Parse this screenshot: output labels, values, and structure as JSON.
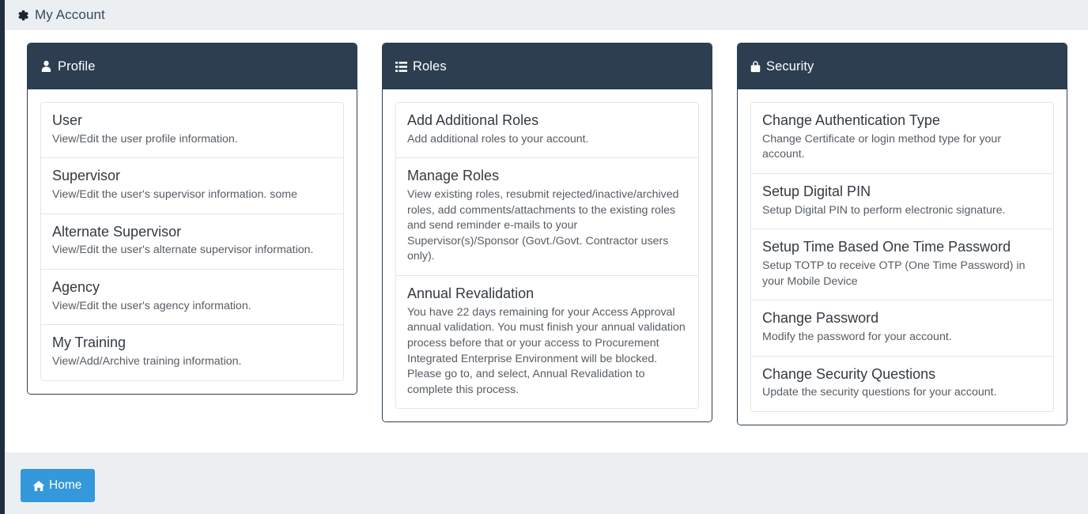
{
  "topbar": {
    "icon": "gear-icon",
    "title": "My Account"
  },
  "panels": [
    {
      "key": "profile",
      "icon": "user-icon",
      "title": "Profile",
      "items": [
        {
          "title": "User",
          "desc": "View/Edit the user profile information."
        },
        {
          "title": "Supervisor",
          "desc": "View/Edit the user's supervisor information. some"
        },
        {
          "title": "Alternate Supervisor",
          "desc": "View/Edit the user's alternate supervisor information."
        },
        {
          "title": "Agency",
          "desc": "View/Edit the user's agency information."
        },
        {
          "title": "My Training",
          "desc": "View/Add/Archive training information."
        }
      ]
    },
    {
      "key": "roles",
      "icon": "list-icon",
      "title": "Roles",
      "items": [
        {
          "title": "Add Additional Roles",
          "desc": "Add additional roles to your account."
        },
        {
          "title": "Manage Roles",
          "desc": "View existing roles, resubmit rejected/inactive/archived roles, add comments/attachments to the existing roles and send reminder e-mails to your Supervisor(s)/Sponsor (Govt./Govt. Contractor users only)."
        },
        {
          "title": "Annual Revalidation",
          "desc": "You have 22 days remaining for your Access Approval annual validation. You must finish your annual validation process before that or your access to Procurement Integrated Enterprise Environment will be blocked. Please go to, and select, Annual Revalidation to complete this process."
        }
      ]
    },
    {
      "key": "security",
      "icon": "lock-icon",
      "title": "Security",
      "items": [
        {
          "title": "Change Authentication Type",
          "desc": "Change Certificate or login method type for your account."
        },
        {
          "title": "Setup Digital PIN",
          "desc": "Setup Digital PIN to perform electronic signature."
        },
        {
          "title": "Setup Time Based One Time Password",
          "desc": "Setup TOTP to receive OTP (One Time Password) in your Mobile Device"
        },
        {
          "title": "Change Password",
          "desc": "Modify the password for your account."
        },
        {
          "title": "Change Security Questions",
          "desc": "Update the security questions for your account."
        }
      ]
    }
  ],
  "footer": {
    "home_label": "Home",
    "home_icon": "home-icon"
  },
  "colors": {
    "panel_header": "#2c3e50",
    "rail": "#1f2d3d",
    "bar_bg": "#eceff1",
    "primary_button": "#3498db",
    "title_text": "#34495e"
  }
}
